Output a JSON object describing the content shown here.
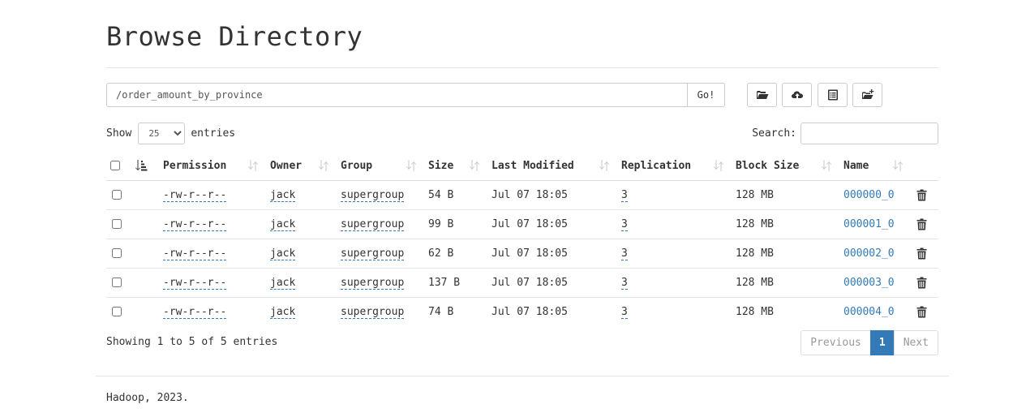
{
  "page": {
    "title": "Browse Directory"
  },
  "path_bar": {
    "path": "/order_amount_by_province",
    "go_label": "Go!"
  },
  "toolbar": {
    "buttons": [
      {
        "name": "create-directory",
        "icon": "folder-open-icon"
      },
      {
        "name": "upload",
        "icon": "cloud-upload-icon"
      },
      {
        "name": "cut-paste",
        "icon": "list-alt-icon"
      },
      {
        "name": "paste",
        "icon": "folder-paste-icon"
      }
    ]
  },
  "length_menu": {
    "show_label": "Show",
    "selected": "25",
    "entries_label": "entries"
  },
  "search": {
    "label": "Search:",
    "value": ""
  },
  "table": {
    "columns": [
      "Permission",
      "Owner",
      "Group",
      "Size",
      "Last Modified",
      "Replication",
      "Block Size",
      "Name"
    ],
    "rows": [
      {
        "permission": "-rw-r--r--",
        "owner": "jack",
        "group": "supergroup",
        "size": "54 B",
        "modified": "Jul 07 18:05",
        "replication": "3",
        "block_size": "128 MB",
        "name": "000000_0"
      },
      {
        "permission": "-rw-r--r--",
        "owner": "jack",
        "group": "supergroup",
        "size": "99 B",
        "modified": "Jul 07 18:05",
        "replication": "3",
        "block_size": "128 MB",
        "name": "000001_0"
      },
      {
        "permission": "-rw-r--r--",
        "owner": "jack",
        "group": "supergroup",
        "size": "62 B",
        "modified": "Jul 07 18:05",
        "replication": "3",
        "block_size": "128 MB",
        "name": "000002_0"
      },
      {
        "permission": "-rw-r--r--",
        "owner": "jack",
        "group": "supergroup",
        "size": "137 B",
        "modified": "Jul 07 18:05",
        "replication": "3",
        "block_size": "128 MB",
        "name": "000003_0"
      },
      {
        "permission": "-rw-r--r--",
        "owner": "jack",
        "group": "supergroup",
        "size": "74 B",
        "modified": "Jul 07 18:05",
        "replication": "3",
        "block_size": "128 MB",
        "name": "000004_0"
      }
    ]
  },
  "pagination": {
    "info": "Showing 1 to 5 of 5 entries",
    "previous": "Previous",
    "current": "1",
    "next": "Next"
  },
  "footer": {
    "text": "Hadoop, 2023."
  },
  "colors": {
    "link": "#337ab7",
    "active_page": "#337ab7",
    "icon": "#333333",
    "sort_icon": "#c8c8c8"
  }
}
